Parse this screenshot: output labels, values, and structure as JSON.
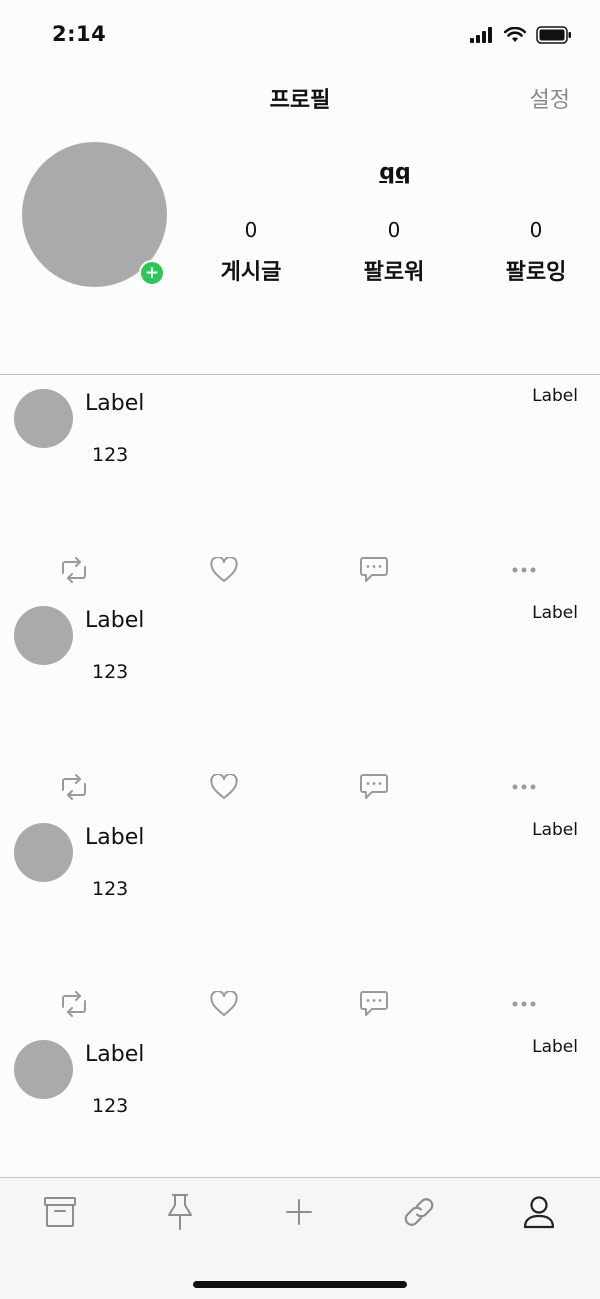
{
  "status_bar": {
    "time": "2:14"
  },
  "nav": {
    "title": "프로필",
    "settings_label": "설정"
  },
  "profile": {
    "username": "qq",
    "stats": [
      {
        "value": "0",
        "label": "게시글"
      },
      {
        "value": "0",
        "label": "팔로워"
      },
      {
        "value": "0",
        "label": "팔로잉"
      }
    ]
  },
  "posts": [
    {
      "name": "Label",
      "tag": "Label",
      "body": "123"
    },
    {
      "name": "Label",
      "tag": "Label",
      "body": "123"
    },
    {
      "name": "Label",
      "tag": "Label",
      "body": "123"
    },
    {
      "name": "Label",
      "tag": "Label",
      "body": "123"
    }
  ],
  "post_actions": [
    "repost-icon",
    "heart-icon",
    "comment-icon",
    "more-icon"
  ],
  "tabs": [
    "archive-icon",
    "pin-icon",
    "plus-icon",
    "link-icon",
    "person-icon"
  ],
  "colors": {
    "avatar": "#aaa9ac",
    "add_badge": "#2dc659",
    "icon_gray": "#9a9a9e",
    "settings_text": "#8a8a8e"
  }
}
